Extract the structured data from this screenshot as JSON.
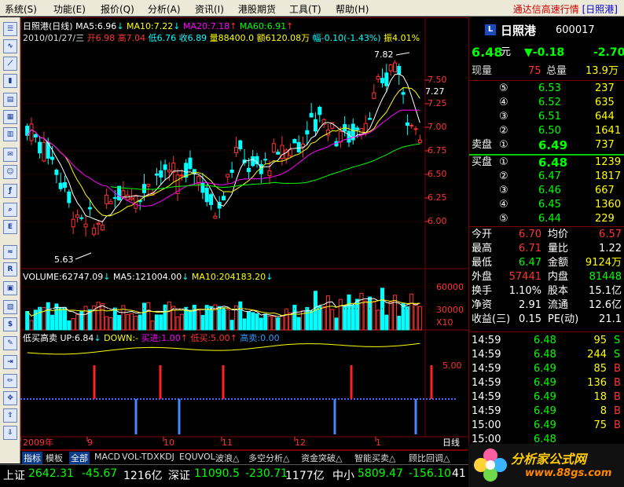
{
  "menu": {
    "items": [
      "系统(S)",
      "功能(E)",
      "报价(Q)",
      "分析(A)",
      "资讯(I)",
      "港股期货",
      "工具(T)",
      "帮助(H)"
    ],
    "brand": "通达信高速行情",
    "brand_code": "[日照港]"
  },
  "chart_header": {
    "title": "日照港(日线)",
    "ma5": "MA5:6.96",
    "ma10": "MA10:7.22",
    "ma20": "MA20:7.18",
    "ma60": "MA60:6.91"
  },
  "chart_info": {
    "date": "2010/01/27/三",
    "open": "开6.98",
    "high": "高7.04",
    "low": "低6.76",
    "close": "收6.89",
    "volume": "量88400.0",
    "amount": "额6120.08万",
    "change": "幅-0.10(-1.43%)",
    "amplitude": "振4.01%"
  },
  "chart_annotations": {
    "high_mark": "7.82",
    "low_mark": "5.63",
    "right_mark": "7.27"
  },
  "price_axis": [
    "7.50",
    "7.25",
    "7.00",
    "6.75",
    "6.50",
    "6.25",
    "6.00"
  ],
  "volume_header": {
    "vol": "VOLUME:62747.09",
    "ma5": "MA5:121004.00",
    "ma10": "MA10:204183.20"
  },
  "volume_axis": [
    "60000",
    "30000",
    "X10"
  ],
  "indicator_header": {
    "name": "低买高卖",
    "up": "UP:6.84",
    "down": "DOWN:-",
    "buy_in": "买进:1.00",
    "low_buy": "低买:5.00",
    "high_sell": "高卖:0.00"
  },
  "indicator_axis": [
    "5.00"
  ],
  "date_axis": [
    "2009年",
    "9",
    "10",
    "11",
    "12",
    "1"
  ],
  "period_label": "日线",
  "bottom_tabs": [
    "指标",
    "模板",
    "全部",
    "MACD",
    "VOL-TDX",
    "KDJ",
    "EQUVOL",
    "波浪△",
    "多空分析△",
    "资金突破△",
    "智能买卖△",
    "顾比回调△"
  ],
  "quote": {
    "name": "日照港",
    "code": "600017",
    "price": "6.48",
    "price_unit": "元",
    "change": "▼-0.18",
    "change_pct": "-2.70",
    "now_vol_label": "现量",
    "now_vol": "75",
    "total_vol_label": "总量",
    "total_vol": "13.9万",
    "sell": [
      {
        "lvl": "⑤",
        "price": "6.53",
        "vol": "237"
      },
      {
        "lvl": "④",
        "price": "6.52",
        "vol": "635"
      },
      {
        "lvl": "③",
        "price": "6.51",
        "vol": "644"
      },
      {
        "lvl": "②",
        "price": "6.50",
        "vol": "1641"
      },
      {
        "lvl": "①",
        "price": "6.49",
        "vol": "737",
        "label": "卖盘"
      }
    ],
    "buy": [
      {
        "lvl": "①",
        "price": "6.48",
        "vol": "1239",
        "label": "买盘"
      },
      {
        "lvl": "②",
        "price": "6.47",
        "vol": "1817"
      },
      {
        "lvl": "③",
        "price": "6.46",
        "vol": "667"
      },
      {
        "lvl": "④",
        "price": "6.45",
        "vol": "1360"
      },
      {
        "lvl": "⑤",
        "price": "6.44",
        "vol": "229"
      }
    ],
    "stats": [
      [
        "今开",
        "6.70",
        "均价",
        "6.57"
      ],
      [
        "最高",
        "6.71",
        "量比",
        "1.22"
      ],
      [
        "最低",
        "6.47",
        "金额",
        "9124万"
      ],
      [
        "外盘",
        "57441",
        "内盘",
        "81448"
      ],
      [
        "换手",
        "1.10%",
        "股本",
        "15.1亿"
      ],
      [
        "净资",
        "2.91",
        "流通",
        "12.6亿"
      ],
      [
        "收益(三)",
        "0.15",
        "PE(动)",
        "21.1"
      ]
    ],
    "ticks": [
      [
        "14:59",
        "6.48",
        "95",
        "S"
      ],
      [
        "14:59",
        "6.48",
        "244",
        "S"
      ],
      [
        "14:59",
        "6.49",
        "85",
        "B"
      ],
      [
        "14:59",
        "6.49",
        "136",
        "B"
      ],
      [
        "14:59",
        "6.49",
        "18",
        "B"
      ],
      [
        "14:59",
        "6.49",
        "8",
        "B"
      ],
      [
        "15:00",
        "6.49",
        "75",
        "B"
      ],
      [
        "15:00",
        "6.48",
        "",
        ""
      ]
    ]
  },
  "status": [
    {
      "name": "上证",
      "value": "2642.31",
      "chg": "-45.67",
      "amt": "1216亿"
    },
    {
      "name": "深证",
      "value": "11090.5",
      "chg": "-230.71",
      "amt": "1177亿"
    },
    {
      "name": "中小",
      "value": "5809.47",
      "chg": "-156.10",
      "amt": "41"
    }
  ],
  "watermark": {
    "title": "分析家公式网",
    "url": "www.88gs.com"
  },
  "colors": {
    "up": "#ff3333",
    "down": "#00ffff",
    "yellow": "#ffff00",
    "green": "#00ff00",
    "purple": "#ff00ff",
    "white": "#ffffff",
    "grid": "#7a0000"
  }
}
